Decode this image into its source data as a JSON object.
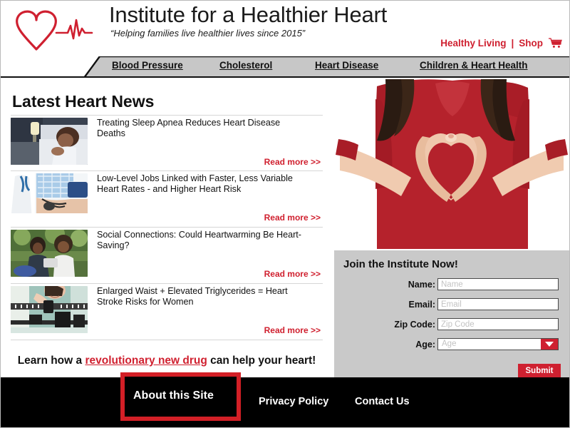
{
  "header": {
    "title": "Institute for a Healthier Heart",
    "tagline": "“Helping families live healthier lives since 2015”",
    "logo_icon": "heart-ekg-logo",
    "top_links": [
      {
        "label": "Healthy Living",
        "icon": null
      },
      {
        "label": "Shop",
        "icon": "shopping-cart-icon"
      }
    ],
    "separator": "|",
    "accent_color": "#cf2030"
  },
  "nav": {
    "items": [
      {
        "label": "Blood Pressure"
      },
      {
        "label": "Cholesterol"
      },
      {
        "label": "Heart Disease"
      },
      {
        "label": "Children & Heart Health"
      }
    ],
    "background_color": "#c7c7c7"
  },
  "news": {
    "heading": "Latest Heart News",
    "read_more_label": "Read more >>",
    "items": [
      {
        "title": "Treating Sleep Apnea Reduces Heart Disease Deaths",
        "thumb": "woman-sleeping-in-bed-photo"
      },
      {
        "title": "Low-Level Jobs Linked with Faster, Less Variable Heart Rates - and Higher Heart Risk",
        "thumb": "doctor-taking-blood-pressure-photo"
      },
      {
        "title": "Social Connections: Could Heartwarming Be Heart-Saving?",
        "thumb": "two-women-talking-outdoors-photo"
      },
      {
        "title": "Enlarged Waist + Elevated Triglycerides = Heart Stroke Risks for Women",
        "thumb": "woman-on-weight-scale-photo"
      }
    ]
  },
  "promo": {
    "prefix": "Learn how a ",
    "highlight": "revolutionary new drug",
    "suffix": " can help your heart!"
  },
  "hero": {
    "alt": "woman-in-red-shirt-making-heart-with-hands-photo"
  },
  "join_form": {
    "heading": "Join the Institute Now!",
    "fields": [
      {
        "label": "Name:",
        "placeholder": "Name",
        "value": "",
        "type": "text"
      },
      {
        "label": "Email:",
        "placeholder": "Email",
        "value": "",
        "type": "text"
      },
      {
        "label": "Zip Code:",
        "placeholder": "Zip Code",
        "value": "",
        "type": "text"
      },
      {
        "label": "Age:",
        "placeholder": "Age",
        "value": "",
        "type": "select"
      }
    ],
    "submit_label": "Submit",
    "panel_color": "#c9c9c9",
    "submit_color": "#cf2030"
  },
  "footer": {
    "links": [
      {
        "label": "About this Site",
        "highlighted": true
      },
      {
        "label": "Privacy Policy",
        "highlighted": false
      },
      {
        "label": "Contact Us",
        "highlighted": false
      }
    ],
    "background_color": "#000000",
    "highlight_color": "#d31f26"
  }
}
